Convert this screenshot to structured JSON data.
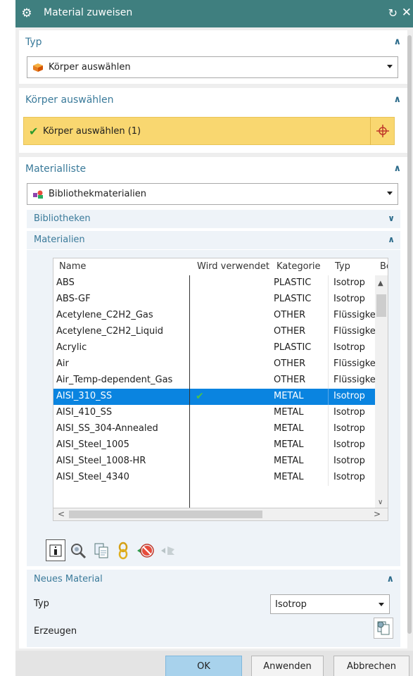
{
  "window": {
    "title": "Material zuweisen",
    "reset_icon": "↻",
    "close_icon": "✕"
  },
  "typ_section": {
    "label": "Typ",
    "dropdown_value": "Körper auswählen"
  },
  "body_section": {
    "label": "Körper auswählen",
    "selection_text": "Körper auswählen (1)"
  },
  "material_list": {
    "label": "Materialliste",
    "dropdown_value": "Bibliothekmaterialien",
    "libraries_label": "Bibliotheken",
    "materials_label": "Materialien",
    "columns": [
      "Name",
      "Wird verwendet",
      "Kategorie",
      "Typ",
      "Be"
    ],
    "rows": [
      {
        "name": "ABS",
        "used": false,
        "category": "PLASTIC",
        "type": "Isotrop"
      },
      {
        "name": "ABS-GF",
        "used": false,
        "category": "PLASTIC",
        "type": "Isotrop"
      },
      {
        "name": "Acetylene_C2H2_Gas",
        "used": false,
        "category": "OTHER",
        "type": "Flüssigkeit"
      },
      {
        "name": "Acetylene_C2H2_Liquid",
        "used": false,
        "category": "OTHER",
        "type": "Flüssigkeit"
      },
      {
        "name": "Acrylic",
        "used": false,
        "category": "PLASTIC",
        "type": "Isotrop"
      },
      {
        "name": "Air",
        "used": false,
        "category": "OTHER",
        "type": "Flüssigkeit"
      },
      {
        "name": "Air_Temp-dependent_Gas",
        "used": false,
        "category": "OTHER",
        "type": "Flüssigkeit"
      },
      {
        "name": "AISI_310_SS",
        "used": true,
        "category": "METAL",
        "type": "Isotrop",
        "selected": true
      },
      {
        "name": "AISI_410_SS",
        "used": false,
        "category": "METAL",
        "type": "Isotrop"
      },
      {
        "name": "AISI_SS_304-Annealed",
        "used": false,
        "category": "METAL",
        "type": "Isotrop"
      },
      {
        "name": "AISI_Steel_1005",
        "used": false,
        "category": "METAL",
        "type": "Isotrop"
      },
      {
        "name": "AISI_Steel_1008-HR",
        "used": false,
        "category": "METAL",
        "type": "Isotrop"
      },
      {
        "name": "AISI_Steel_4340",
        "used": false,
        "category": "METAL",
        "type": "Isotrop"
      }
    ],
    "toolbar_icons": [
      "info-icon",
      "inspect-icon",
      "copy-icon",
      "link-icon",
      "delete-material-icon",
      "unassign-icon"
    ]
  },
  "new_material": {
    "label": "Neues Material",
    "type_label": "Typ",
    "type_value": "Isotrop",
    "create_label": "Erzeugen"
  },
  "footer": {
    "ok": "OK",
    "apply": "Anwenden",
    "cancel": "Abbrechen"
  },
  "colors": {
    "titlebar": "#3f7f7f",
    "accent_text": "#3a7a9a",
    "selection_row": "#0a84e0",
    "selection_bar": "#f9d770",
    "ok_button": "#a8d2ec"
  }
}
